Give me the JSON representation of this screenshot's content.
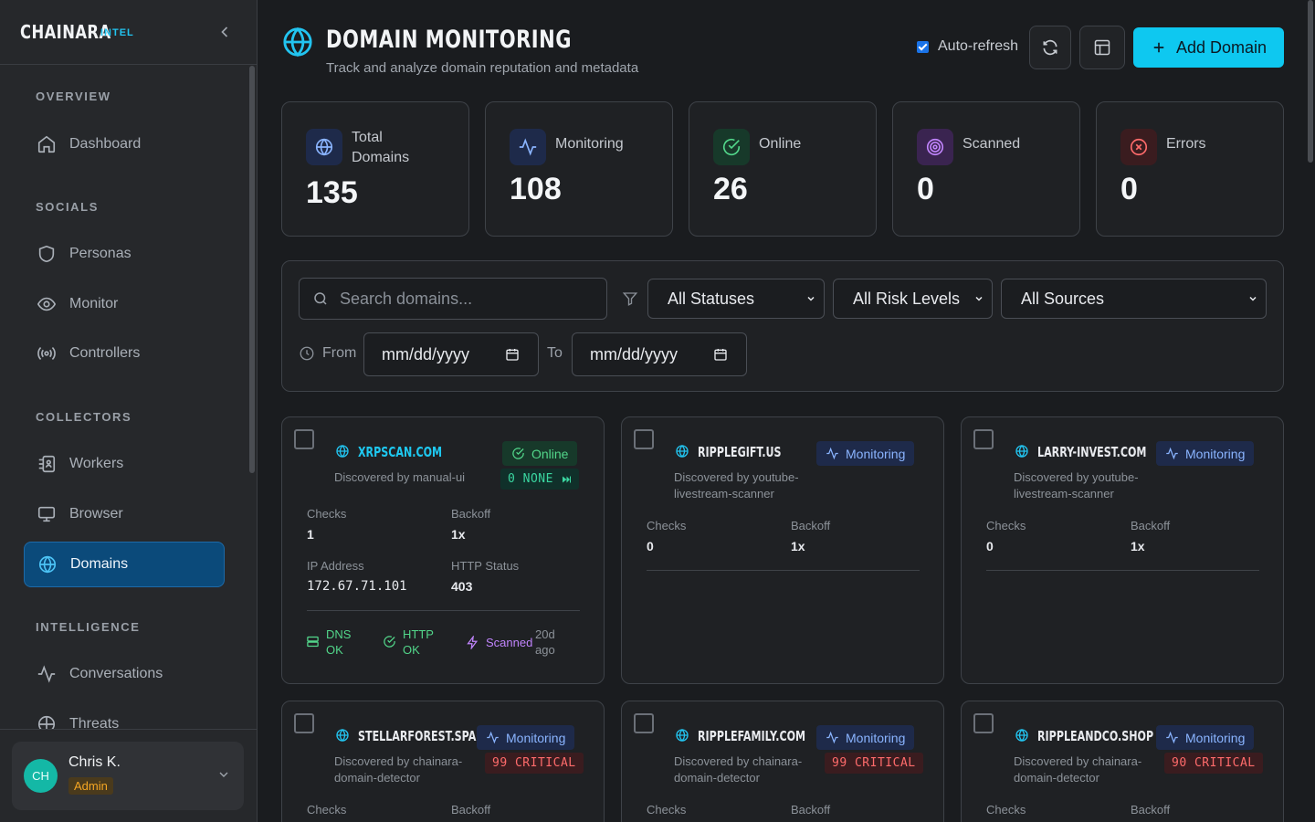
{
  "brand": {
    "name": "CHAINARA",
    "tag": "INTEL"
  },
  "sidebar": {
    "sections": [
      {
        "title": "OVERVIEW",
        "items": [
          {
            "label": "Dashboard",
            "icon": "home-icon"
          }
        ]
      },
      {
        "title": "SOCIALS",
        "items": [
          {
            "label": "Personas",
            "icon": "shield-icon"
          },
          {
            "label": "Monitor",
            "icon": "eye-icon"
          },
          {
            "label": "Controllers",
            "icon": "broadcast-icon"
          }
        ]
      },
      {
        "title": "COLLECTORS",
        "items": [
          {
            "label": "Workers",
            "icon": "worker-icon"
          },
          {
            "label": "Browser",
            "icon": "monitor-icon"
          },
          {
            "label": "Domains",
            "icon": "globe-icon",
            "active": true
          }
        ]
      },
      {
        "title": "INTELLIGENCE",
        "items": [
          {
            "label": "Conversations",
            "icon": "activity-icon"
          },
          {
            "label": "Threats",
            "icon": "threat-icon"
          }
        ]
      }
    ],
    "user": {
      "initials": "CH",
      "name": "Chris K.",
      "role": "Admin"
    }
  },
  "header": {
    "title": "DOMAIN MONITORING",
    "subtitle": "Track and analyze domain reputation and metadata",
    "auto_refresh_label": "Auto-refresh",
    "auto_refresh_checked": true,
    "add_label": "Add Domain"
  },
  "stats": [
    {
      "label": "Total Domains",
      "value": "135",
      "icon": "globe-icon",
      "color": "#8ab4ff"
    },
    {
      "label": "Monitoring",
      "value": "108",
      "icon": "activity-icon",
      "color": "#8ab4ff"
    },
    {
      "label": "Online",
      "value": "26",
      "icon": "check-circle-icon",
      "color": "#52d68a"
    },
    {
      "label": "Scanned",
      "value": "0",
      "icon": "target-icon",
      "color": "#c084fc"
    },
    {
      "label": "Errors",
      "value": "0",
      "icon": "x-circle-icon",
      "color": "#ff6b6b"
    }
  ],
  "filters": {
    "search_placeholder": "Search domains...",
    "status": "All Statuses",
    "risk": "All Risk Levels",
    "source": "All Sources",
    "from_label": "From",
    "to_label": "To",
    "from_placeholder": "mm/dd/yyyy",
    "to_placeholder": "mm/dd/yyyy"
  },
  "labels": {
    "checks": "Checks",
    "backoff": "Backoff",
    "ip": "IP Address",
    "http": "HTTP Status"
  },
  "cards": [
    {
      "domain": "XRPSCAN.COM",
      "discovered": "Discovered by manual-ui",
      "status": "Online",
      "risk": "0 NONE",
      "checks": "1",
      "backoff": "1x",
      "ip": "172.67.71.101",
      "http": "403",
      "dns": "DNS OK",
      "http_ok": "HTTP OK",
      "scanned": "Scanned",
      "ago": "20d ago"
    },
    {
      "domain": "RIPPLEGIFT.US",
      "discovered": "Discovered by youtube-livestream-scanner",
      "status": "Monitoring",
      "checks": "0",
      "backoff": "1x"
    },
    {
      "domain": "LARRY-INVEST.COM",
      "discovered": "Discovered by youtube-livestream-scanner",
      "status": "Monitoring",
      "checks": "0",
      "backoff": "1x"
    },
    {
      "domain": "STELLARFOREST.SPACE",
      "discovered": "Discovered by chainara-domain-detector",
      "status": "Monitoring",
      "risk": "99 CRITICAL"
    },
    {
      "domain": "RIPPLEFAMILY.COM",
      "discovered": "Discovered by chainara-domain-detector",
      "status": "Monitoring",
      "risk": "99 CRITICAL"
    },
    {
      "domain": "RIPPLEANDCO.SHOP",
      "discovered": "Discovered by chainara-domain-detector",
      "status": "Monitoring",
      "risk": "90 CRITICAL"
    }
  ]
}
